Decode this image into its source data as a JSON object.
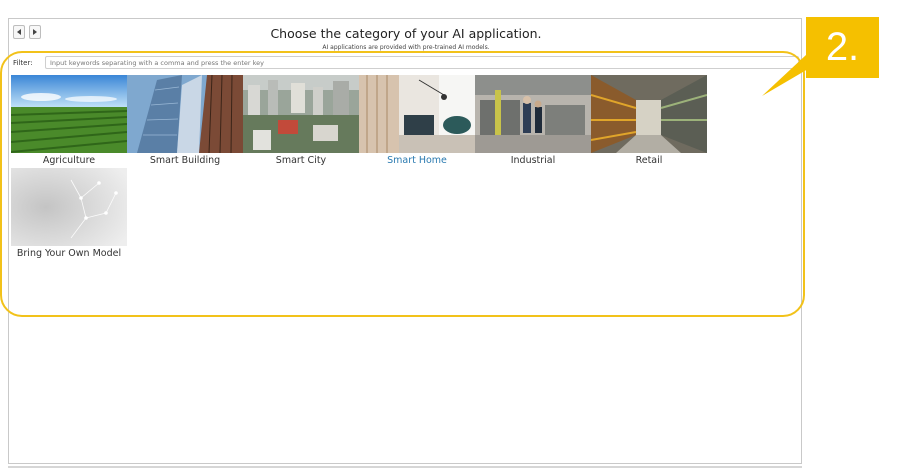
{
  "window": {
    "title": "Choose the category of your AI application.",
    "subtitle": "AI applications are provided with pre-trained AI models."
  },
  "filter": {
    "label": "Filter:",
    "placeholder": "Input keywords separating with a comma and press the enter key",
    "value": ""
  },
  "categories": [
    {
      "label": "Agriculture",
      "selected": false
    },
    {
      "label": "Smart Building",
      "selected": false
    },
    {
      "label": "Smart City",
      "selected": false
    },
    {
      "label": "Smart Home",
      "selected": true
    },
    {
      "label": "Industrial",
      "selected": false
    },
    {
      "label": "Retail",
      "selected": false
    },
    {
      "label": "Bring Your Own Model",
      "selected": false
    }
  ],
  "annotation": {
    "step": "2.",
    "color": "#f5c000"
  },
  "colors": {
    "selected_text": "#2a7ab0",
    "highlight": "#f2c21a"
  }
}
